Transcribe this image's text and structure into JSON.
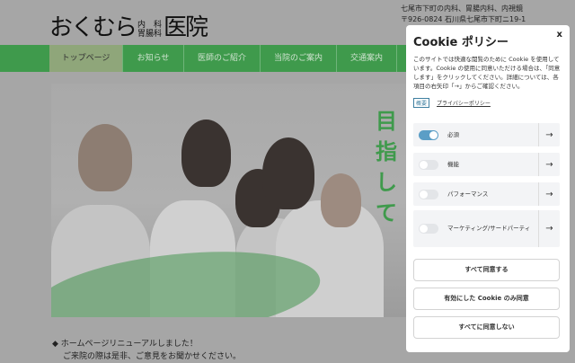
{
  "header": {
    "logo_main": "おくむら",
    "logo_sub_top": "内　科",
    "logo_sub_bottom": "胃腸科",
    "logo_end": "医院",
    "tagline": "七尾市下町の内科、胃腸内科、内視鏡",
    "address": "〒926-0824 石川県七尾市下町ニ19-1"
  },
  "nav": [
    "トップページ",
    "お知らせ",
    "医師のご紹介",
    "当院のご案内",
    "交通案内"
  ],
  "hero": {
    "vertical_text": "目指して"
  },
  "news": {
    "headline": "ホームページリニューアルしました！",
    "body": "ご来院の際は是非、ご意見をお聞かせください。"
  },
  "cookie": {
    "title": "Cookie ポリシー",
    "close": "x",
    "description": "このサイトでは快適な閲覧のために Cookie を使用しています。Cookie の使用に同意いただける場合は、「同意します」をクリックしてください。詳細については、各項目の右矢印「→」からご確認ください。",
    "badge": "概要",
    "privacy_link": "プライバシーポリシー",
    "categories": [
      {
        "label": "必須",
        "enabled": true
      },
      {
        "label": "機能",
        "enabled": false
      },
      {
        "label": "パフォーマンス",
        "enabled": false
      },
      {
        "label": "マーケティング/サードパーティ",
        "enabled": false
      }
    ],
    "arrow": "→",
    "buttons": {
      "accept_all": "すべて同意する",
      "accept_selected": "有効にした Cookie のみ同意",
      "reject_all": "すべてに同意しない"
    }
  }
}
